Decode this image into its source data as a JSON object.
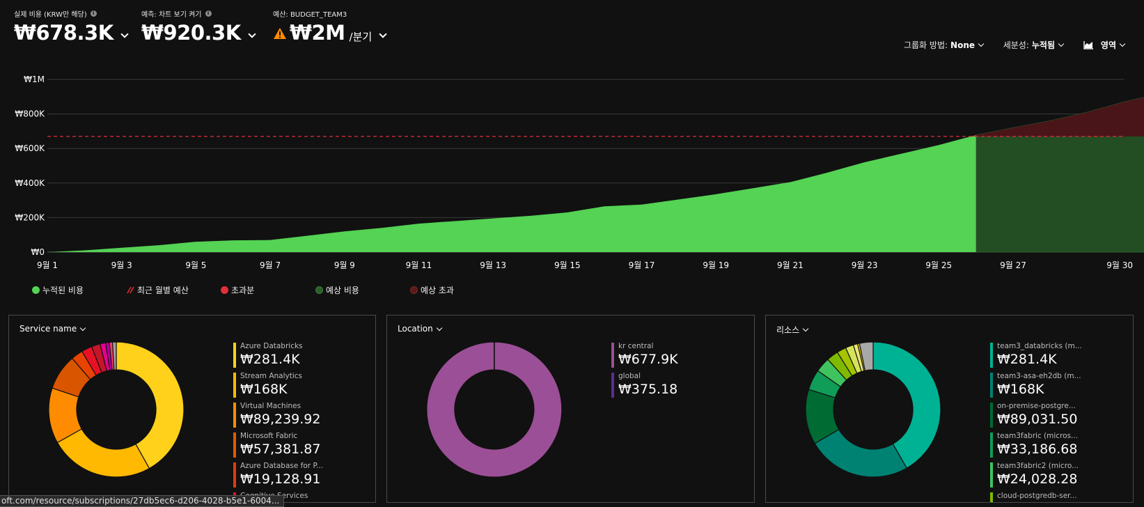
{
  "metrics": {
    "actual_label": "실제 비용 (KRW만 해당)",
    "actual_value": "₩678.3K",
    "forecast_label": "예측: 차트 보기 켜기",
    "forecast_value": "₩920.3K",
    "budget_label": "예산: BUDGET_TEAM3",
    "budget_value": "₩2M",
    "budget_unit": "/분기"
  },
  "controls": {
    "group_label": "그룹화 방법:",
    "group_value": "None",
    "granularity_label": "세분성:",
    "granularity_value": "누적됨",
    "view_label": "영역"
  },
  "chart_data": {
    "type": "area",
    "x": [
      "9월 1",
      "9월 2",
      "9월 3",
      "9월 4",
      "9월 5",
      "9월 6",
      "9월 7",
      "9월 8",
      "9월 9",
      "9월 10",
      "9월 11",
      "9월 12",
      "9월 13",
      "9월 14",
      "9월 15",
      "9월 16",
      "9월 17",
      "9월 18",
      "9월 19",
      "9월 20",
      "9월 21",
      "9월 22",
      "9월 23",
      "9월 24",
      "9월 25",
      "9월 26",
      "9월 27",
      "9월 28",
      "9월 29",
      "9월 30"
    ],
    "x_tick_labels": [
      "9월 1",
      "9월 3",
      "9월 5",
      "9월 7",
      "9월 9",
      "9월 11",
      "9월 13",
      "9월 15",
      "9월 17",
      "9월 19",
      "9월 21",
      "9월 23",
      "9월 25",
      "9월 27",
      "9월 30"
    ],
    "y_tick_labels": [
      "₩0",
      "₩200K",
      "₩400K",
      "₩600K",
      "₩800K",
      "₩1M"
    ],
    "ylim": [
      0,
      1000000
    ],
    "budget_line": 670000,
    "series": [
      {
        "name": "누적된 비용",
        "color": "#54d354",
        "values": [
          0,
          10000,
          25000,
          40000,
          60000,
          68000,
          70000,
          95000,
          120000,
          140000,
          165000,
          180000,
          195000,
          210000,
          230000,
          265000,
          275000,
          305000,
          335000,
          370000,
          405000,
          460000,
          520000,
          570000,
          620000,
          678000
        ]
      },
      {
        "name": "예상 비용",
        "color": "#234d23",
        "values": [
          678000,
          720000,
          760000,
          810000,
          870000,
          920000
        ]
      }
    ],
    "forecast_start": "9월 25"
  },
  "legend": [
    {
      "label": "누적된 비용",
      "color": "#54d354",
      "kind": "dot"
    },
    {
      "label": "최근 월별 예산",
      "color": "#e0303a",
      "kind": "hatch"
    },
    {
      "label": "초과분",
      "color": "#e0303a",
      "kind": "dot"
    },
    {
      "label": "예상 비용",
      "color": "#2a5e2a",
      "kind": "dot"
    },
    {
      "label": "예상 초과",
      "color": "#5a1a1a",
      "kind": "dot"
    }
  ],
  "panels": [
    {
      "title": "Service name",
      "items": [
        {
          "name": "Azure Databricks",
          "amount": "₩281.4K",
          "color": "#ffd11a"
        },
        {
          "name": "Stream Analytics",
          "amount": "₩168K",
          "color": "#ffb900"
        },
        {
          "name": "Virtual Machines",
          "amount": "₩89,239.92",
          "color": "#ff8c00"
        },
        {
          "name": "Microsoft Fabric",
          "amount": "₩57,381.87",
          "color": "#e05a00"
        },
        {
          "name": "Azure Database for P...",
          "amount": "₩19,128.91",
          "color": "#e03a10"
        },
        {
          "name": "Cognitive Services",
          "amount": "",
          "color": "#e81123"
        }
      ],
      "slices": [
        {
          "value": 281.4,
          "color": "#ffd11a"
        },
        {
          "value": 168,
          "color": "#ffb900"
        },
        {
          "value": 89.24,
          "color": "#ff8c00"
        },
        {
          "value": 57.38,
          "color": "#d95500"
        },
        {
          "value": 19.13,
          "color": "#e84300"
        },
        {
          "value": 17,
          "color": "#e81123"
        },
        {
          "value": 14,
          "color": "#c4162a"
        },
        {
          "value": 9,
          "color": "#e3008c"
        },
        {
          "value": 6,
          "color": "#b4009e"
        },
        {
          "value": 5,
          "color": "#ff3c6e"
        },
        {
          "value": 6,
          "color": "#a0a0a0"
        }
      ]
    },
    {
      "title": "Location",
      "items": [
        {
          "name": "kr central",
          "amount": "₩677.9K",
          "color": "#9b4f96"
        },
        {
          "name": "global",
          "amount": "₩375.18",
          "color": "#5c2d91"
        }
      ],
      "slices": [
        {
          "value": 677.9,
          "color": "#9b4f96"
        },
        {
          "value": 0.375,
          "color": "#5c2d91"
        }
      ]
    },
    {
      "title": "리소스",
      "items": [
        {
          "name": "team3_databricks (m...",
          "amount": "₩281.4K",
          "color": "#00b294"
        },
        {
          "name": "team3-asa-eh2db (m...",
          "amount": "₩168K",
          "color": "#008272"
        },
        {
          "name": "on-premise-postgre...",
          "amount": "₩89,031.50",
          "color": "#006b33"
        },
        {
          "name": "team3fabric (micros...",
          "amount": "₩33,186.68",
          "color": "#0f9d58"
        },
        {
          "name": "team3fabric2 (micro...",
          "amount": "₩24,028.28",
          "color": "#3fc35f"
        },
        {
          "name": "cloud-postgredb-ser...",
          "amount": "",
          "color": "#7fba00"
        }
      ],
      "slices": [
        {
          "value": 281.4,
          "color": "#00b294"
        },
        {
          "value": 168,
          "color": "#008272"
        },
        {
          "value": 89.03,
          "color": "#006b33"
        },
        {
          "value": 33.19,
          "color": "#0f9d58"
        },
        {
          "value": 24.03,
          "color": "#3fc35f"
        },
        {
          "value": 19,
          "color": "#7fba00"
        },
        {
          "value": 15,
          "color": "#a4c400"
        },
        {
          "value": 13,
          "color": "#d6e35a"
        },
        {
          "value": 7,
          "color": "#e8e87a"
        },
        {
          "value": 3,
          "color": "#ffd800"
        },
        {
          "value": 22,
          "color": "#a8a8a8"
        }
      ]
    }
  ],
  "statusbar": {
    "url": "oft.com/resource/subscriptions/27db5ec6-d206-4028-b5e1-6004..."
  }
}
